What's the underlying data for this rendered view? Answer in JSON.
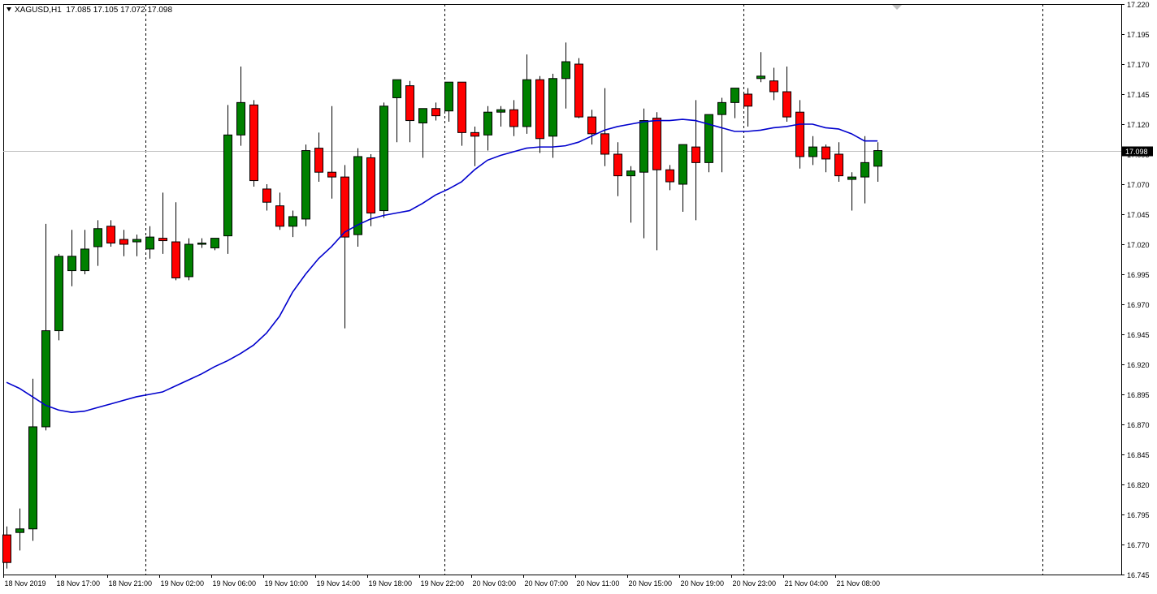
{
  "header": {
    "symbol_title": "XAGUSD,H1",
    "ohlc": "17.085 17.105 17.072 17.098"
  },
  "colors": {
    "bull": "#008000",
    "bear": "#ff0000",
    "ma": "#0000cd",
    "grid": "#000000",
    "axis": "#000000",
    "price_line": "#c0c0c0",
    "price_label_bg": "#000000",
    "price_label_fg": "#ffffff"
  },
  "chart_data": {
    "type": "candlestick",
    "symbol": "XAGUSD",
    "timeframe": "H1",
    "ylim": [
      16.745,
      17.22
    ],
    "y_ticks": [
      "17.220",
      "17.195",
      "17.170",
      "17.145",
      "17.120",
      "17.095",
      "17.070",
      "17.045",
      "17.020",
      "16.995",
      "16.970",
      "16.945",
      "16.920",
      "16.895",
      "16.870",
      "16.845",
      "16.820",
      "16.795",
      "16.770",
      "16.745"
    ],
    "current_price": "17.098",
    "time_labels": [
      {
        "label": "18 Nov 2019",
        "index": 0
      },
      {
        "label": "18 Nov 17:00",
        "index": 4
      },
      {
        "label": "18 Nov 21:00",
        "index": 8
      },
      {
        "label": "19 Nov 02:00",
        "index": 12
      },
      {
        "label": "19 Nov 06:00",
        "index": 16
      },
      {
        "label": "19 Nov 10:00",
        "index": 20
      },
      {
        "label": "19 Nov 14:00",
        "index": 24
      },
      {
        "label": "19 Nov 18:00",
        "index": 28
      },
      {
        "label": "19 Nov 22:00",
        "index": 32
      },
      {
        "label": "20 Nov 03:00",
        "index": 36
      },
      {
        "label": "20 Nov 07:00",
        "index": 40
      },
      {
        "label": "20 Nov 11:00",
        "index": 44
      },
      {
        "label": "20 Nov 15:00",
        "index": 48
      },
      {
        "label": "20 Nov 19:00",
        "index": 52
      },
      {
        "label": "20 Nov 23:00",
        "index": 56
      },
      {
        "label": "21 Nov 04:00",
        "index": 60
      },
      {
        "label": "21 Nov 08:00",
        "index": 64
      }
    ],
    "day_separators": [
      10.7,
      33.7,
      56.7,
      79.7
    ],
    "ohlc": [
      [
        16.778,
        16.785,
        16.75,
        16.755
      ],
      [
        16.78,
        16.8,
        16.765,
        16.783
      ],
      [
        16.783,
        16.908,
        16.773,
        16.868
      ],
      [
        16.868,
        17.037,
        16.865,
        16.948
      ],
      [
        16.948,
        17.012,
        16.94,
        17.01
      ],
      [
        16.998,
        17.032,
        16.985,
        17.01
      ],
      [
        16.998,
        17.032,
        16.995,
        17.016
      ],
      [
        17.018,
        17.04,
        17.002,
        17.033
      ],
      [
        17.035,
        17.04,
        17.018,
        17.021
      ],
      [
        17.024,
        17.032,
        17.01,
        17.02
      ],
      [
        17.022,
        17.028,
        17.01,
        17.024
      ],
      [
        17.016,
        17.035,
        17.008,
        17.026
      ],
      [
        17.025,
        17.063,
        17.012,
        17.023
      ],
      [
        17.022,
        17.055,
        16.99,
        16.992
      ],
      [
        16.993,
        17.025,
        16.99,
        17.02
      ],
      [
        17.021,
        17.025,
        17.017,
        17.021
      ],
      [
        17.017,
        17.025,
        17.015,
        17.025
      ],
      [
        17.027,
        17.136,
        17.012,
        17.111
      ],
      [
        17.111,
        17.168,
        17.102,
        17.138
      ],
      [
        17.136,
        17.14,
        17.068,
        17.073
      ],
      [
        17.066,
        17.07,
        17.048,
        17.055
      ],
      [
        17.052,
        17.063,
        17.032,
        17.035
      ],
      [
        17.035,
        17.048,
        17.026,
        17.043
      ],
      [
        17.041,
        17.103,
        17.035,
        17.098
      ],
      [
        17.1,
        17.113,
        17.072,
        17.08
      ],
      [
        17.08,
        17.135,
        17.058,
        17.076
      ],
      [
        17.076,
        17.086,
        16.95,
        17.026
      ],
      [
        17.028,
        17.1,
        17.018,
        17.093
      ],
      [
        17.092,
        17.095,
        17.035,
        17.046
      ],
      [
        17.048,
        17.138,
        17.042,
        17.135
      ],
      [
        17.142,
        17.157,
        17.105,
        17.157
      ],
      [
        17.152,
        17.156,
        17.105,
        17.123
      ],
      [
        17.121,
        17.125,
        17.092,
        17.133
      ],
      [
        17.133,
        17.138,
        17.123,
        17.127
      ],
      [
        17.131,
        17.14,
        17.122,
        17.155
      ],
      [
        17.155,
        17.155,
        17.102,
        17.113
      ],
      [
        17.113,
        17.118,
        17.085,
        17.11
      ],
      [
        17.111,
        17.135,
        17.098,
        17.13
      ],
      [
        17.13,
        17.135,
        17.118,
        17.132
      ],
      [
        17.132,
        17.14,
        17.11,
        17.118
      ],
      [
        17.118,
        17.178,
        17.112,
        17.157
      ],
      [
        17.157,
        17.16,
        17.096,
        17.108
      ],
      [
        17.11,
        17.162,
        17.092,
        17.158
      ],
      [
        17.158,
        17.188,
        17.133,
        17.172
      ],
      [
        17.17,
        17.175,
        17.125,
        17.126
      ],
      [
        17.126,
        17.132,
        17.103,
        17.112
      ],
      [
        17.112,
        17.15,
        17.085,
        17.095
      ],
      [
        17.095,
        17.105,
        17.06,
        17.077
      ],
      [
        17.077,
        17.085,
        17.038,
        17.081
      ],
      [
        17.08,
        17.133,
        17.025,
        17.123
      ],
      [
        17.125,
        17.13,
        17.015,
        17.082
      ],
      [
        17.082,
        17.086,
        17.065,
        17.072
      ],
      [
        17.07,
        17.1,
        17.047,
        17.103
      ],
      [
        17.101,
        17.14,
        17.04,
        17.088
      ],
      [
        17.088,
        17.11,
        17.08,
        17.128
      ],
      [
        17.128,
        17.142,
        17.08,
        17.138
      ],
      [
        17.138,
        17.15,
        17.125,
        17.15
      ],
      [
        17.145,
        17.15,
        17.118,
        17.135
      ],
      [
        17.158,
        17.18,
        17.155,
        17.16
      ],
      [
        17.156,
        17.167,
        17.14,
        17.147
      ],
      [
        17.147,
        17.168,
        17.122,
        17.126
      ],
      [
        17.13,
        17.14,
        17.083,
        17.093
      ],
      [
        17.093,
        17.11,
        17.086,
        17.101
      ],
      [
        17.101,
        17.103,
        17.08,
        17.091
      ],
      [
        17.095,
        17.105,
        17.072,
        17.077
      ],
      [
        17.074,
        17.08,
        17.048,
        17.076
      ],
      [
        17.076,
        17.11,
        17.054,
        17.088
      ],
      [
        17.085,
        17.105,
        17.072,
        17.098
      ]
    ],
    "ma_series": [
      {
        "name": "",
        "values": [
          16.905,
          16.9,
          16.893,
          16.886,
          16.882,
          16.88,
          16.881,
          16.884,
          16.887,
          16.89,
          16.893,
          16.895,
          16.897,
          16.902,
          16.907,
          16.912,
          16.918,
          16.923,
          16.929,
          16.936,
          16.946,
          16.96,
          16.98,
          16.995,
          17.008,
          17.018,
          17.03,
          17.036,
          17.041,
          17.044,
          17.046,
          17.048,
          17.054,
          17.061,
          17.066,
          17.072,
          17.082,
          17.09,
          17.094,
          17.097,
          17.1,
          17.101,
          17.101,
          17.102,
          17.105,
          17.11,
          17.115,
          17.118,
          17.12,
          17.122,
          17.123,
          17.123,
          17.124,
          17.123,
          17.12,
          17.117,
          17.114,
          17.114,
          17.115,
          17.117,
          17.118,
          17.12,
          17.12,
          17.117,
          17.116,
          17.112,
          17.106,
          17.106
        ]
      }
    ]
  }
}
